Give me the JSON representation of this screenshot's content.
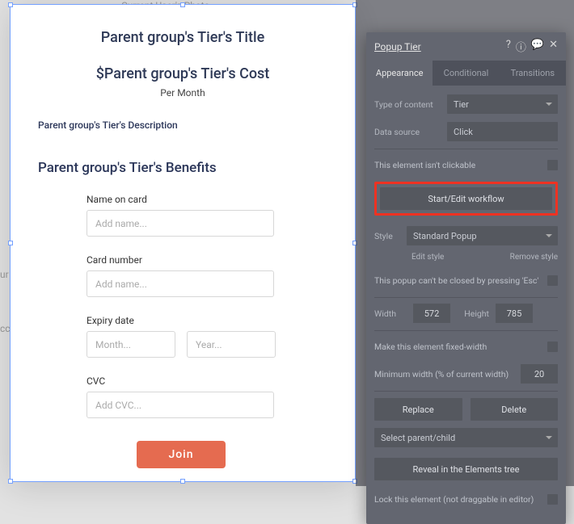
{
  "background": {
    "topLeftText": "Current User's Photo"
  },
  "popup": {
    "title": "Parent group's Tier's Title",
    "cost": "$Parent group's Tier's Cost",
    "period": "Per Month",
    "description": "Parent group's Tier's Description",
    "benefits": "Parent group's Tier's Benefits",
    "fields": {
      "nameLabel": "Name on card",
      "namePlaceholder": "Add name...",
      "cardLabel": "Card number",
      "cardPlaceholder": "Add name...",
      "expiryLabel": "Expiry date",
      "monthPlaceholder": "Month...",
      "yearPlaceholder": "Year...",
      "cvcLabel": "CVC",
      "cvcPlaceholder": "Add CVC..."
    },
    "joinLabel": "Join"
  },
  "editor": {
    "title": "Popup Tier",
    "tabs": {
      "appearance": "Appearance",
      "conditional": "Conditional",
      "transitions": "Transitions"
    },
    "typeLabel": "Type of content",
    "typeValue": "Tier",
    "dataSourceLabel": "Data source",
    "dataSourceValue": "Click",
    "notClickable": "This element isn't clickable",
    "workflowBtn": "Start/Edit workflow",
    "styleLabel": "Style",
    "styleValue": "Standard Popup",
    "editStyle": "Edit style",
    "removeStyle": "Remove style",
    "escText": "This popup can't be closed by pressing 'Esc'",
    "widthLabel": "Width",
    "widthValue": "572",
    "heightLabel": "Height",
    "heightValue": "785",
    "fixedWidth": "Make this element fixed-width",
    "minWidthLabel": "Minimum width (% of current width)",
    "minWidthValue": "20",
    "replace": "Replace",
    "delete": "Delete",
    "selectParent": "Select parent/child",
    "reveal": "Reveal in the Elements tree",
    "lock": "Lock this element (not draggable in editor)"
  }
}
